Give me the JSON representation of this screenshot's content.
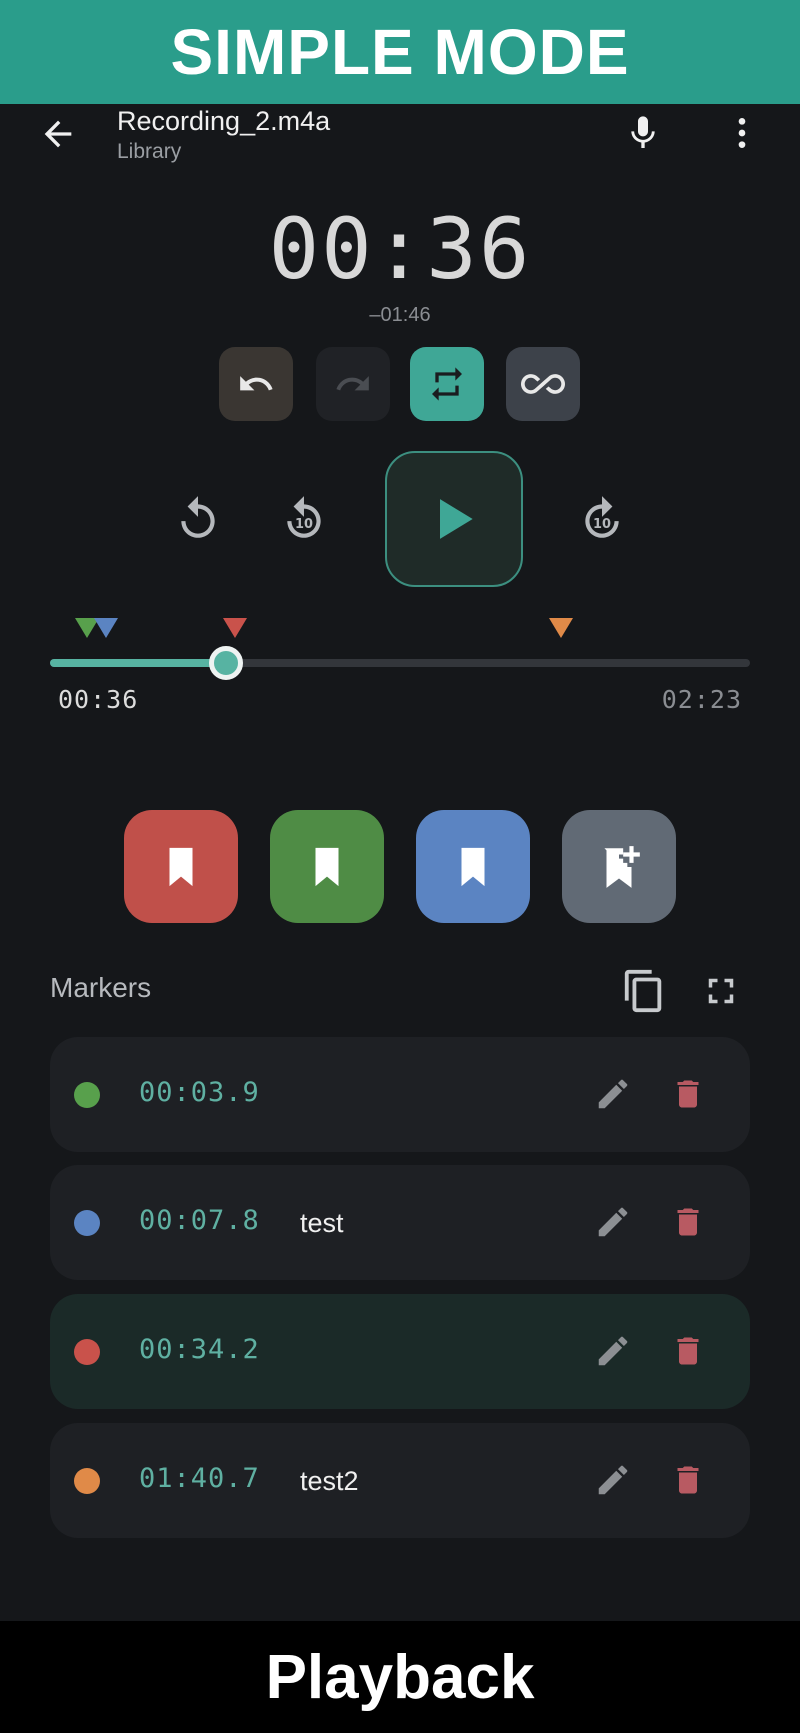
{
  "banner": {
    "text": "SIMPLE MODE"
  },
  "appbar": {
    "title": "Recording_2.m4a",
    "subtitle": "Library"
  },
  "player": {
    "elapsed_large": "00:36",
    "remaining": "‒01:46",
    "position_label": "00:36",
    "duration_label": "02:23",
    "progress_fraction": 0.252,
    "toggles": [
      {
        "name": "undo",
        "icon": "undo-icon"
      },
      {
        "name": "redo",
        "icon": "redo-icon"
      },
      {
        "name": "repeat",
        "icon": "repeat-icon",
        "active": true
      },
      {
        "name": "infinite-loop",
        "icon": "infinity-icon"
      }
    ]
  },
  "colors": {
    "accent": "#57b3a2",
    "red": "#c0504a",
    "green": "#4f8c45",
    "blue": "#5b84c2",
    "orange": "#e08a48",
    "delete": "#b85a62"
  },
  "bookmark_buttons": [
    {
      "color": "red",
      "icon": "bookmark-icon"
    },
    {
      "color": "green",
      "icon": "bookmark-icon"
    },
    {
      "color": "blue",
      "icon": "bookmark-icon"
    },
    {
      "color": "gray",
      "icon": "bookmark-add-icon"
    }
  ],
  "markers": {
    "label": "Markers",
    "items": [
      {
        "time": "00:03.9",
        "name": "",
        "color": "#58a04c"
      },
      {
        "time": "00:07.8",
        "name": "test",
        "color": "#5b84c2"
      },
      {
        "time": "00:34.2",
        "name": "",
        "color": "#c9524b",
        "active": true
      },
      {
        "time": "01:40.7",
        "name": "test2",
        "color": "#e08a48"
      }
    ]
  },
  "footer": {
    "text": "Playback"
  }
}
